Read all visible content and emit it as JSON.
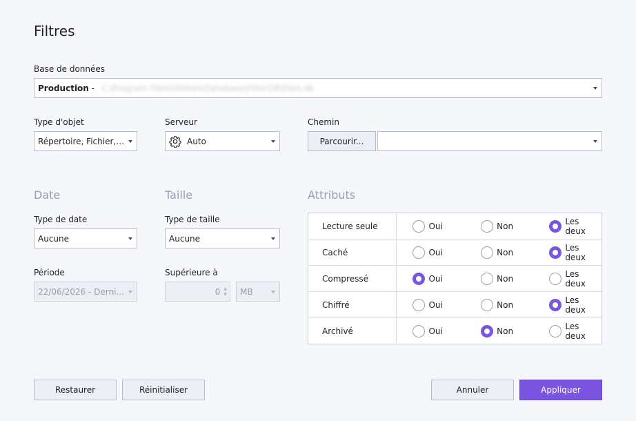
{
  "title": "Filtres",
  "database": {
    "label": "Base de données",
    "name": "Production",
    "separator": " - ",
    "path": "C:\\Program Files\\Utilities\\Database\\FilterDB\\Files.db"
  },
  "object_type": {
    "label": "Type d'objet",
    "value": "Répertoire, Fichier, l..."
  },
  "server": {
    "label": "Serveur",
    "value": "Auto",
    "icon": "gear-icon"
  },
  "path": {
    "label": "Chemin",
    "browse_label": "Parcourir...",
    "value": ""
  },
  "date": {
    "section": "Date",
    "type_label": "Type de date",
    "type_value": "Aucune",
    "period_label": "Période",
    "period_value": "22/06/2026 - Dernie..."
  },
  "size": {
    "section": "Taille",
    "type_label": "Type de taille",
    "type_value": "Aucune",
    "greater_label": "Supérieure à",
    "greater_value": "0",
    "unit_value": "MB"
  },
  "attributes": {
    "section": "Attributs",
    "options": [
      "Oui",
      "Non",
      "Les deux"
    ],
    "rows": [
      {
        "name": "Lecture seule",
        "selected": 2
      },
      {
        "name": "Caché",
        "selected": 2
      },
      {
        "name": "Compressé",
        "selected": 0
      },
      {
        "name": "Chiffré",
        "selected": 2
      },
      {
        "name": "Archivé",
        "selected": 1
      }
    ]
  },
  "buttons": {
    "restore": "Restaurer",
    "reset": "Réinitialiser",
    "cancel": "Annuler",
    "apply": "Appliquer"
  },
  "colors": {
    "accent": "#7a55e0",
    "background": "#f6f7fb"
  }
}
